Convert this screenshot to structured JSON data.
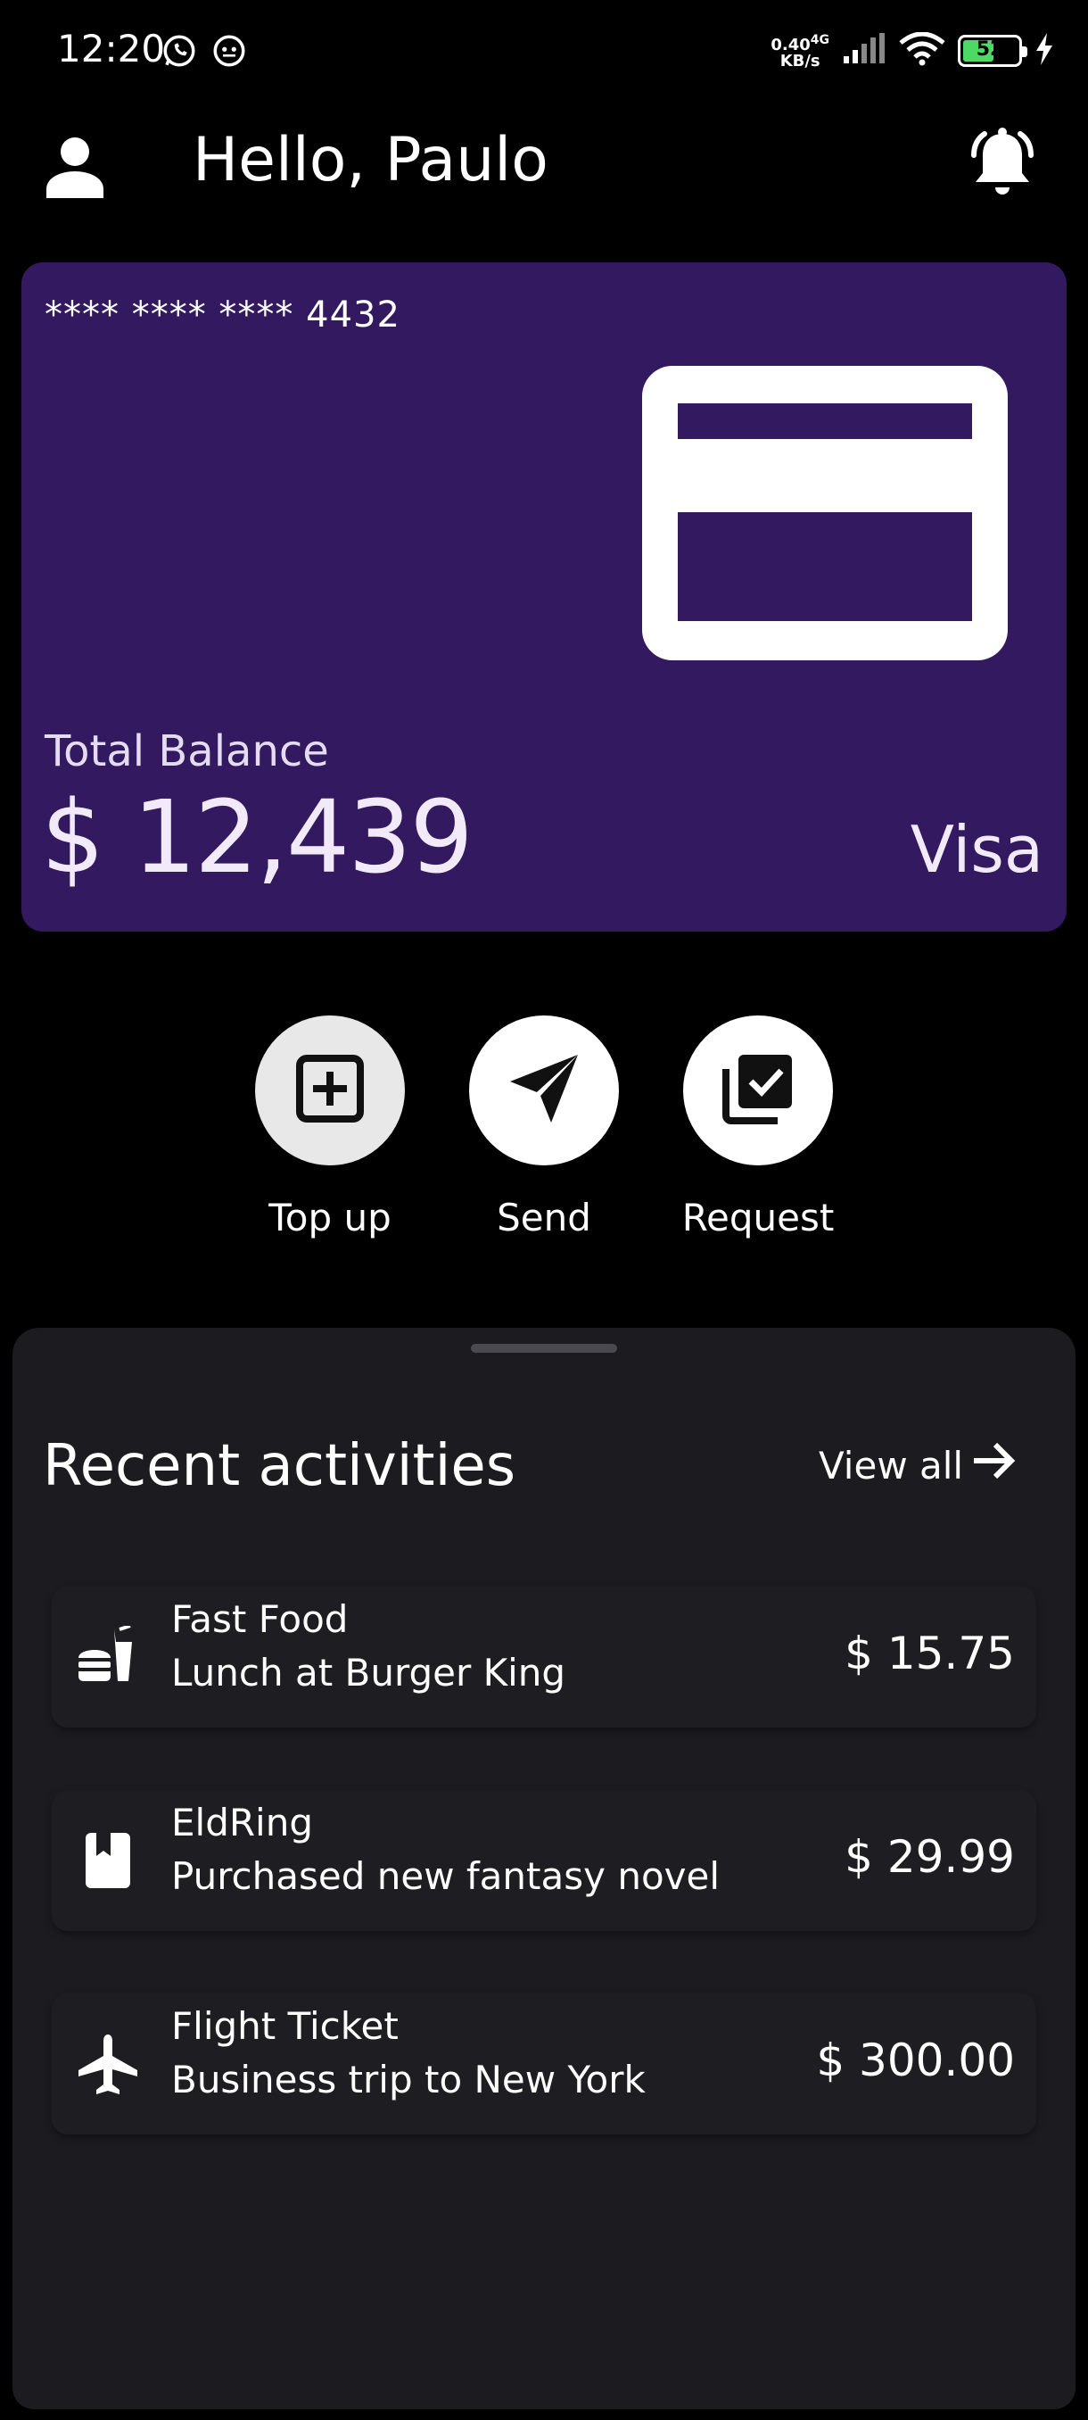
{
  "status_bar": {
    "time": "12:20",
    "net_speed_value": "0.40",
    "net_speed_unit": "KB/s",
    "network_type": "4G",
    "battery": "52",
    "left_icons": [
      "whatsapp-icon",
      "app-notification-icon"
    ],
    "right_icons": [
      "signal-icon",
      "wifi-icon",
      "battery-icon",
      "charging-icon"
    ]
  },
  "header": {
    "greeting": "Hello, Paulo",
    "avatar_icon": "person-icon",
    "notification_icon": "bell-icon"
  },
  "card": {
    "number": "**** **** **** 4432",
    "icon": "credit-card-icon",
    "balance_label": "Total Balance",
    "balance": "$ 12,439",
    "brand": "Visa",
    "color": "#331960"
  },
  "actions": [
    {
      "label": "Top up",
      "icon": "add-box-icon"
    },
    {
      "label": "Send",
      "icon": "send-icon"
    },
    {
      "label": "Request",
      "icon": "library-add-check-icon"
    }
  ],
  "activities_section": {
    "title": "Recent activities",
    "view_all": "View all",
    "view_all_icon": "arrow-right-icon",
    "items": [
      {
        "icon": "fastfood-icon",
        "title": "Fast Food",
        "description": "Lunch at Burger King",
        "amount": "$ 15.75"
      },
      {
        "icon": "book-icon",
        "title": "EldRing",
        "description": "Purchased new fantasy novel",
        "amount": "$ 29.99"
      },
      {
        "icon": "airplane-icon",
        "title": "Flight Ticket",
        "description": "Business trip to New York",
        "amount": "$ 300.00"
      }
    ]
  },
  "colors": {
    "background": "#000000",
    "card": "#331960",
    "sheet": "#1c1b1f",
    "text": "#ffffff"
  }
}
